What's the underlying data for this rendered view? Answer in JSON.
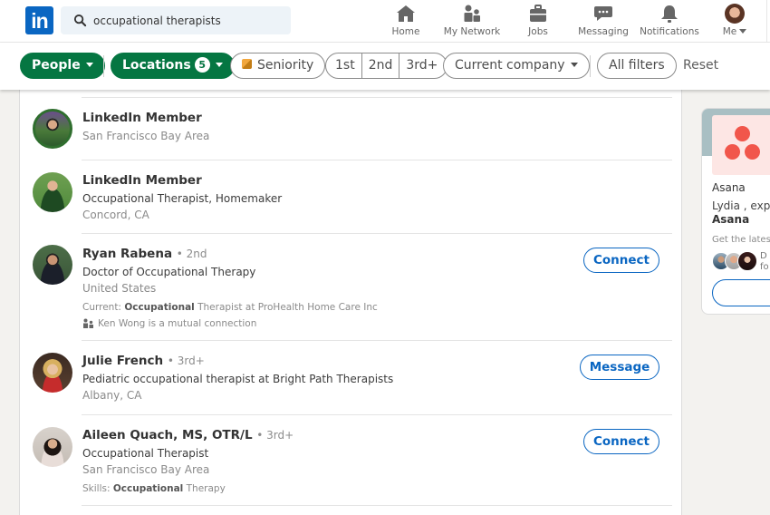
{
  "nav": {
    "logo": "in",
    "search": {
      "value": "occupational therapists",
      "placeholder": "Search"
    },
    "items": [
      {
        "label": "Home",
        "icon": "home-icon"
      },
      {
        "label": "My Network",
        "icon": "network-icon"
      },
      {
        "label": "Jobs",
        "icon": "briefcase-icon"
      },
      {
        "label": "Messaging",
        "icon": "chat-bubble-icon"
      },
      {
        "label": "Notifications",
        "icon": "bell-icon"
      },
      {
        "label": "Me",
        "icon": "avatar"
      }
    ]
  },
  "filters": {
    "people": "People",
    "locations": "Locations",
    "locations_count": "5",
    "seniority": "Seniority",
    "degrees": [
      "1st",
      "2nd",
      "3rd+"
    ],
    "current_company": "Current company",
    "all_filters": "All filters",
    "reset": "Reset",
    "active_color": "#057642"
  },
  "results": [
    {
      "name": "LinkedIn Member",
      "degree": "",
      "headline": "",
      "location": "San Francisco Bay Area",
      "action": ""
    },
    {
      "name": "LinkedIn Member",
      "degree": "",
      "headline": "Occupational Therapist, Homemaker",
      "location": "Concord, CA",
      "action": ""
    },
    {
      "name": "Ryan Rabena",
      "degree": "• 2nd",
      "headline": "Doctor of Occupational Therapy",
      "location": "United States",
      "extra_prefix": "Current: ",
      "extra_bold": "Occupational",
      "extra_suffix": " Therapist at ProHealth Home Care Inc",
      "mutual": "Ken Wong is a mutual connection",
      "action": "Connect"
    },
    {
      "name": "Julie French",
      "degree": "• 3rd+",
      "headline": "Pediatric occupational therapist at Bright Path Therapists",
      "location": "Albany, CA",
      "action": "Message"
    },
    {
      "name": "Aileen Quach, MS, OTR/L",
      "degree": "• 3rd+",
      "headline": "Occupational Therapist",
      "location": "San Francisco Bay Area",
      "extra_prefix": "Skills: ",
      "extra_bold": "Occupational",
      "extra_suffix": " Therapy",
      "action": "Connect"
    }
  ],
  "ad": {
    "company": "Asana",
    "text_line1": "Lydia , explo",
    "text_line2": "Asana",
    "subtext": "Get the latest",
    "faces_text_line1": "D",
    "faces_text_line2": "fo",
    "brand_color": "#f1564b"
  }
}
